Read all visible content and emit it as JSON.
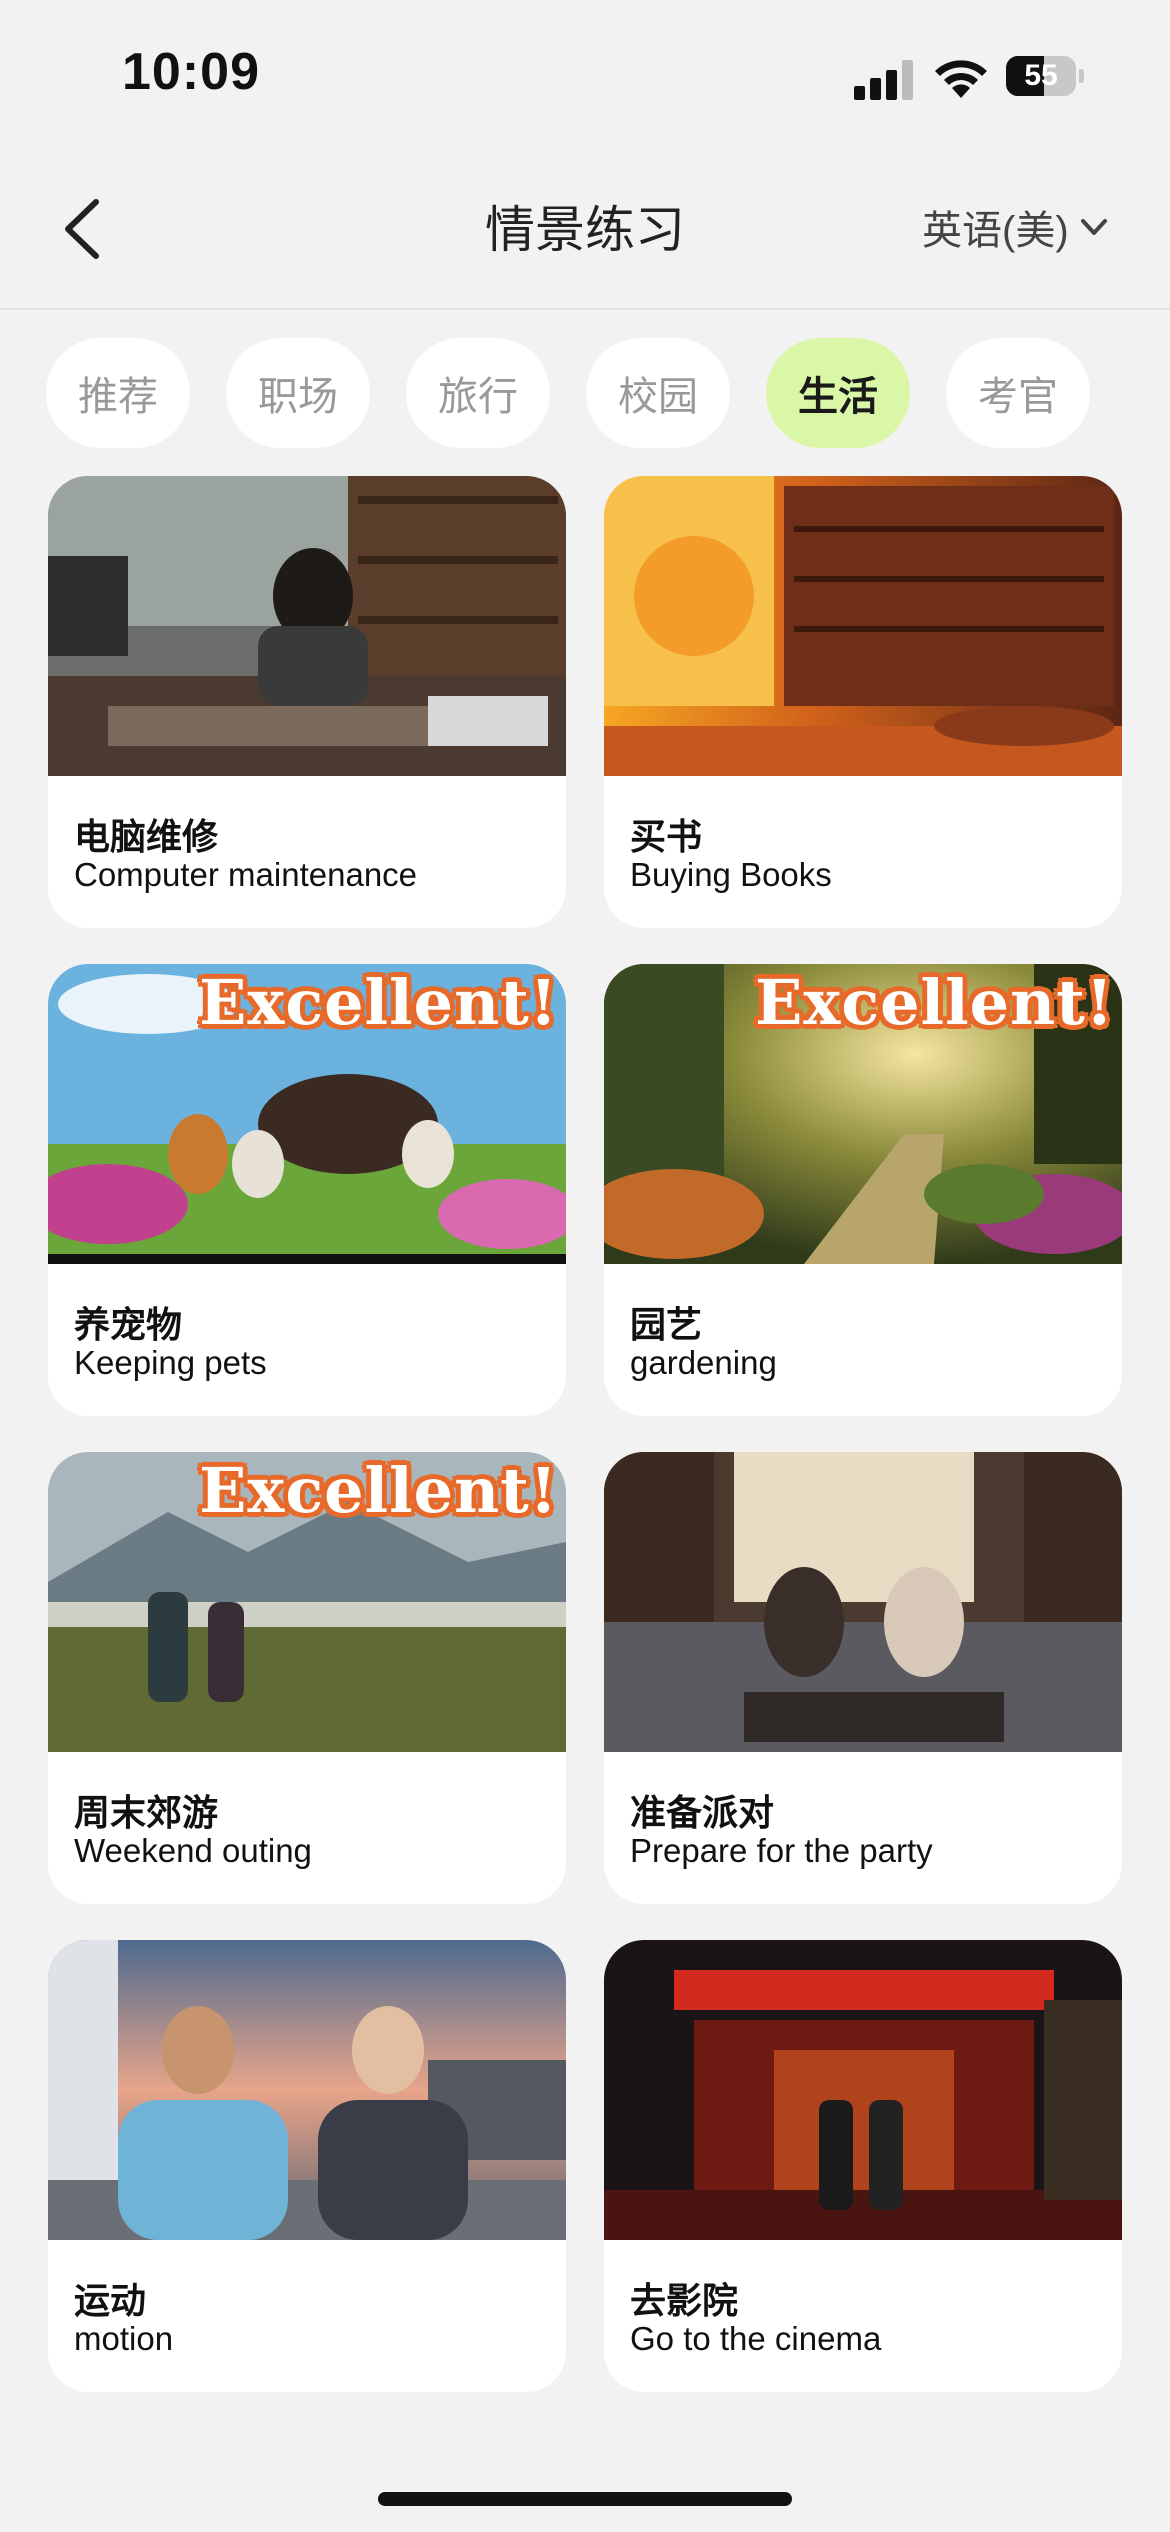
{
  "status_bar": {
    "time": "10:09",
    "battery": "55"
  },
  "nav": {
    "title": "情景练习",
    "language": "英语(美)"
  },
  "tabs": [
    {
      "label": "推荐",
      "active": false
    },
    {
      "label": "职场",
      "active": false
    },
    {
      "label": "旅行",
      "active": false
    },
    {
      "label": "校园",
      "active": false
    },
    {
      "label": "生活",
      "active": true
    },
    {
      "label": "考官",
      "active": false
    }
  ],
  "cards": [
    {
      "zh": "电脑维修",
      "en": "Computer maintenance",
      "badge": ""
    },
    {
      "zh": "买书",
      "en": "Buying Books",
      "badge": ""
    },
    {
      "zh": "养宠物",
      "en": "Keeping pets",
      "badge": "Excellent!"
    },
    {
      "zh": "园艺",
      "en": "gardening",
      "badge": "Excellent!"
    },
    {
      "zh": "周末郊游",
      "en": "Weekend outing",
      "badge": "Excellent!"
    },
    {
      "zh": "准备派对",
      "en": "Prepare for the party",
      "badge": ""
    },
    {
      "zh": "运动",
      "en": "motion",
      "badge": ""
    },
    {
      "zh": "去影院",
      "en": "Go to the cinema",
      "badge": ""
    }
  ],
  "icons": {
    "back": "chevron-left-icon",
    "language_dropdown": "chevron-down-icon",
    "signal": "cellular-signal-icon",
    "wifi": "wifi-icon",
    "battery": "battery-icon"
  },
  "colors": {
    "active_tab": "#d9f7a6",
    "badge_outline": "#e76a2a",
    "background": "#f2f2f2"
  }
}
